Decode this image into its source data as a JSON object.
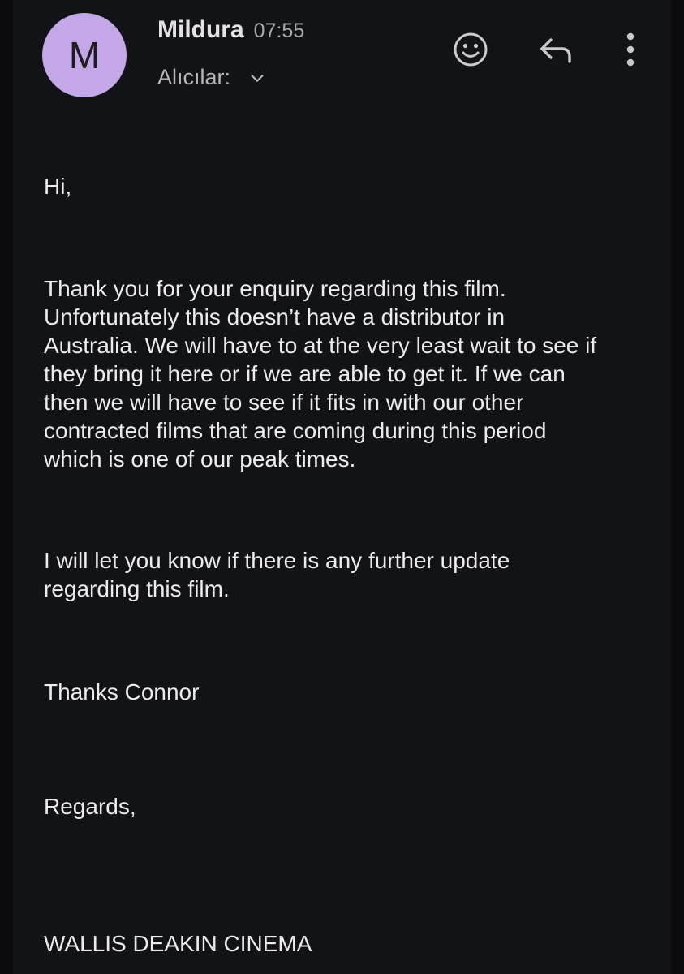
{
  "header": {
    "avatar_letter": "M",
    "avatar_color": "#c4a7e7",
    "sender_name": "Mildura",
    "time": "07:55",
    "recipients_label": "Alıcılar:",
    "expand_icon": "chevron-down-icon",
    "actions": {
      "emoji_icon": "emoji-reaction-icon",
      "reply_icon": "reply-icon",
      "more_icon": "more-vert-icon"
    }
  },
  "message": {
    "greeting": "Hi,",
    "paragraph_1": "Thank you for your enquiry regarding this film.\nUnfortunately this doesn’t have a distributor in\nAustralia. We will have to at the very least wait to see if\nthey bring it here or if we are able to get it. If we can\nthen we will have to see if it fits in with our other\ncontracted films that are coming during this period\nwhich is one of our peak times.",
    "paragraph_2": "I will let you know if there is any further update\nregarding this film.",
    "thanks": "Thanks Connor",
    "regards": "Regards,",
    "signature": "WALLIS DEAKIN CINEMA"
  },
  "colors": {
    "background": "#121317",
    "text": "#ececee",
    "secondary_text": "#a9a9b0"
  }
}
